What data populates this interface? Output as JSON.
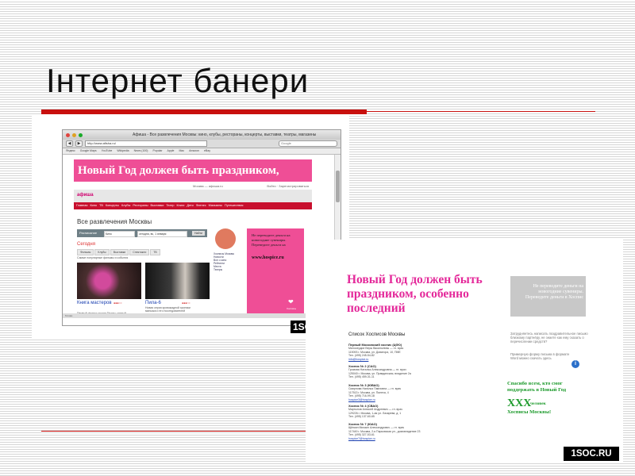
{
  "slide": {
    "title": "Інтернет банери",
    "watermark": "1SOC.RU",
    "watermark_partial": "1SO"
  },
  "browser": {
    "window_title": "Афиша - Все развлечения Москвы: кино, клубы, рестораны, концерты, выставки, театры, магазины",
    "nav_back": "◀",
    "nav_forward": "▶",
    "url": "http://www.afisha.ru/",
    "search_placeholder": "Google",
    "bookmarks": [
      "Яндекс",
      "Google Maps",
      "YouTube",
      "Wikipedia",
      "News (100)",
      "Popular",
      "Apple",
      "Mac",
      "Amazon",
      "eBay"
    ]
  },
  "page": {
    "banner_text": "Новый Год должен быть праздником,",
    "info_left": "Москва — афиша.ru",
    "info_right": "Войти · Зарегистрироваться",
    "logo": "афиша",
    "nav": [
      "Главная",
      "Кино",
      "ТВ",
      "Концерты",
      "Клубы",
      "Рестораны",
      "Выставки",
      "Театр",
      "Книги",
      "Дети",
      "Фитнес",
      "Магазины",
      "Путешествия"
    ],
    "section_title": "Все развлечения Москвы",
    "filter": {
      "label": "Расписание",
      "box1": "Кино",
      "box2": "сегодня, вс, 1 января",
      "button": "Найти"
    },
    "today": "Сегодня",
    "tabs": [
      "Фильмы",
      "Клубы",
      "Выставки",
      "Спектакли",
      "ТВ"
    ],
    "hint": "Самые популярные фильмы и события",
    "card1": {
      "title": "Книга мастеров",
      "text1": "Первый фильм студии Disney, снятый",
      "text2": "в России",
      "meta": "Купить билеты"
    },
    "card2": {
      "title": "Пила-6",
      "text1": "Новая серия кровожадной хроники",
      "text2": "маньяка и его последователей",
      "meta": "Купить билеты"
    },
    "rating": "●●●○○",
    "side_ad": {
      "text": "Не переводите деньги на новогодние сувениры. Переведите деньги на",
      "url": "www.hospice.ru",
      "heart_label": "Хосписы"
    },
    "mid_col": [
      "Хосписы Москвы",
      "Новости",
      "Все о кино",
      "Рейтинги",
      "Места",
      "Театры"
    ],
    "status": "Готово"
  },
  "banner_doc": {
    "headline": "Новый Год должен быть праздником, особенно последний",
    "grey_box": "Не переводите деньги на новогодние сувениры. Переведите деньги в Хоспис",
    "list_title": "Список Хосписов Москвы",
    "hospices": [
      {
        "name": "Первый Московский хоспис (ЦФО)",
        "lines": [
          "Милосердие Веры Васильевны — гл. врач",
          "115093 г. Москва, ул. Доватора, 10, ПМЕ",
          "Тел. (495) 245-54-82"
        ],
        "link": "info@hospice.ru"
      },
      {
        "name": "Хоспис № 2 (САО)",
        "lines": [
          "Громова Наталья Александровна — гл. врач",
          "125040 г. Москва, ул. Правдинская, владение 2а",
          "Тел. (495) 459-31-11"
        ],
        "link": ""
      },
      {
        "name": "Хоспис № 3 (ЮВАО)",
        "lines": [
          "Смирнова Наталья Павловна — гл. врач",
          "117513 г. Москва, ул. Палеха, 4",
          "Тел. (495) 716-99-18"
        ],
        "link": "hospice3@hospice.ru"
      },
      {
        "name": "Хоспис № 4 (СВАО)",
        "lines": [
          "Мартынов Алексей Андреевич — гл. врач",
          "129226 г. Москва, 1-ая ул. Лазарева, д. 1",
          "Тел. (495) 137-60-65"
        ],
        "link": ""
      },
      {
        "name": "Хоспис № 7 (ЮАО)",
        "lines": [
          "Щёпкин Михаил Александрович — гл. врач",
          "117449 г. Москва, 2-я Парковская ул., домовладение 23",
          "Тел. (495) 327-53-61"
        ],
        "link": "hospice7@hospice.ru"
      }
    ],
    "note1": "Затрудняетесь написать поздравительное письмо близкому партнёру, не знаете как ему сказать о перечислении средств?",
    "note2": "Примерную форму письма в формате Word можно скачать здесь",
    "info_icon": "i",
    "green_text": "Спасибо всем, кто смог поддержать в Новый Год",
    "green_count": "ХХХ",
    "green_people": "человек",
    "green_thanks": "Хосписы Москвы!"
  },
  "colors": {
    "accent_red": "#c8100e",
    "pink": "#ef4e96",
    "banner_pink": "#e4299a",
    "green": "#1c9a2b"
  }
}
